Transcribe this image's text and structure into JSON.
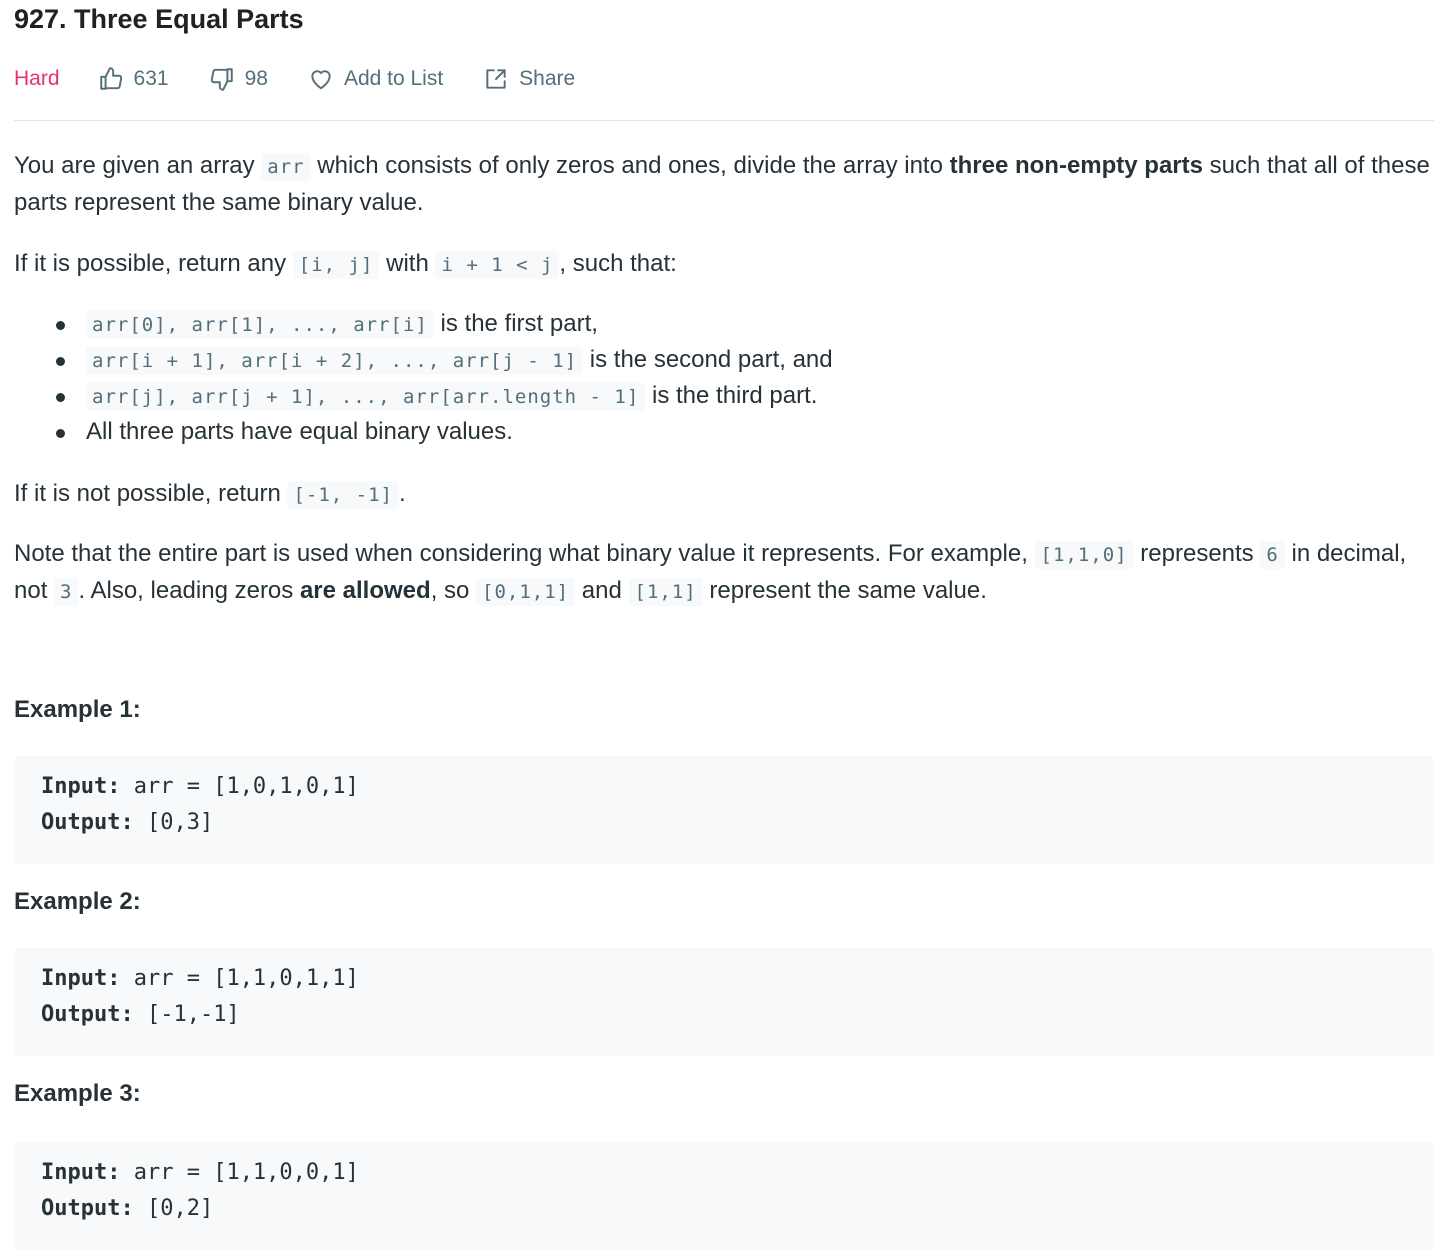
{
  "problem": {
    "title": "927. Three Equal Parts",
    "difficulty": "Hard",
    "likes": "631",
    "dislikes": "98",
    "add_to_list_label": "Add to List",
    "share_label": "Share",
    "difficulty_color": "#e8336a"
  },
  "description": {
    "p1": {
      "t1": "You are given an array ",
      "c1": "arr",
      "t2": " which consists of only zeros and ones, divide the array into ",
      "b1": "three non-empty parts",
      "t3": " such that all of these parts represent the same binary value."
    },
    "p2": {
      "t1": "If it is possible, return any ",
      "c1": "[i, j]",
      "t2": " with ",
      "c2": "i + 1 < j",
      "t3": ", such that:"
    },
    "bullets": [
      {
        "code": "arr[0], arr[1], ..., arr[i]",
        "text": " is the first part,"
      },
      {
        "code": "arr[i + 1], arr[i + 2], ..., arr[j - 1]",
        "text": " is the second part, and"
      },
      {
        "code": "arr[j], arr[j + 1], ..., arr[arr.length - 1]",
        "text": " is the third part."
      },
      {
        "code": "",
        "text": "All three parts have equal binary values."
      }
    ],
    "p3": {
      "t1": "If it is not possible, return ",
      "c1": "[-1, -1]",
      "t2": "."
    },
    "p4": {
      "t1": "Note that the entire part is used when considering what binary value it represents. For example, ",
      "c1": "[1,1,0]",
      "t2": " represents ",
      "c2": "6",
      "t3": " in decimal, not ",
      "c3": "3",
      "t4": ". Also, leading zeros ",
      "b1": "are allowed",
      "t5": ", so ",
      "c4": "[0,1,1]",
      "t6": " and ",
      "c5": "[1,1]",
      "t7": " represent the same value."
    }
  },
  "examples": [
    {
      "heading": "Example 1:",
      "input_label": "Input:",
      "input": " arr = [1,0,1,0,1]",
      "output_label": "Output:",
      "output": " [0,3]"
    },
    {
      "heading": "Example 2:",
      "input_label": "Input:",
      "input": " arr = [1,1,0,1,1]",
      "output_label": "Output:",
      "output": " [-1,-1]"
    },
    {
      "heading": "Example 3:",
      "input_label": "Input:",
      "input": " arr = [1,1,0,0,1]",
      "output_label": "Output:",
      "output": " [0,2]"
    }
  ]
}
